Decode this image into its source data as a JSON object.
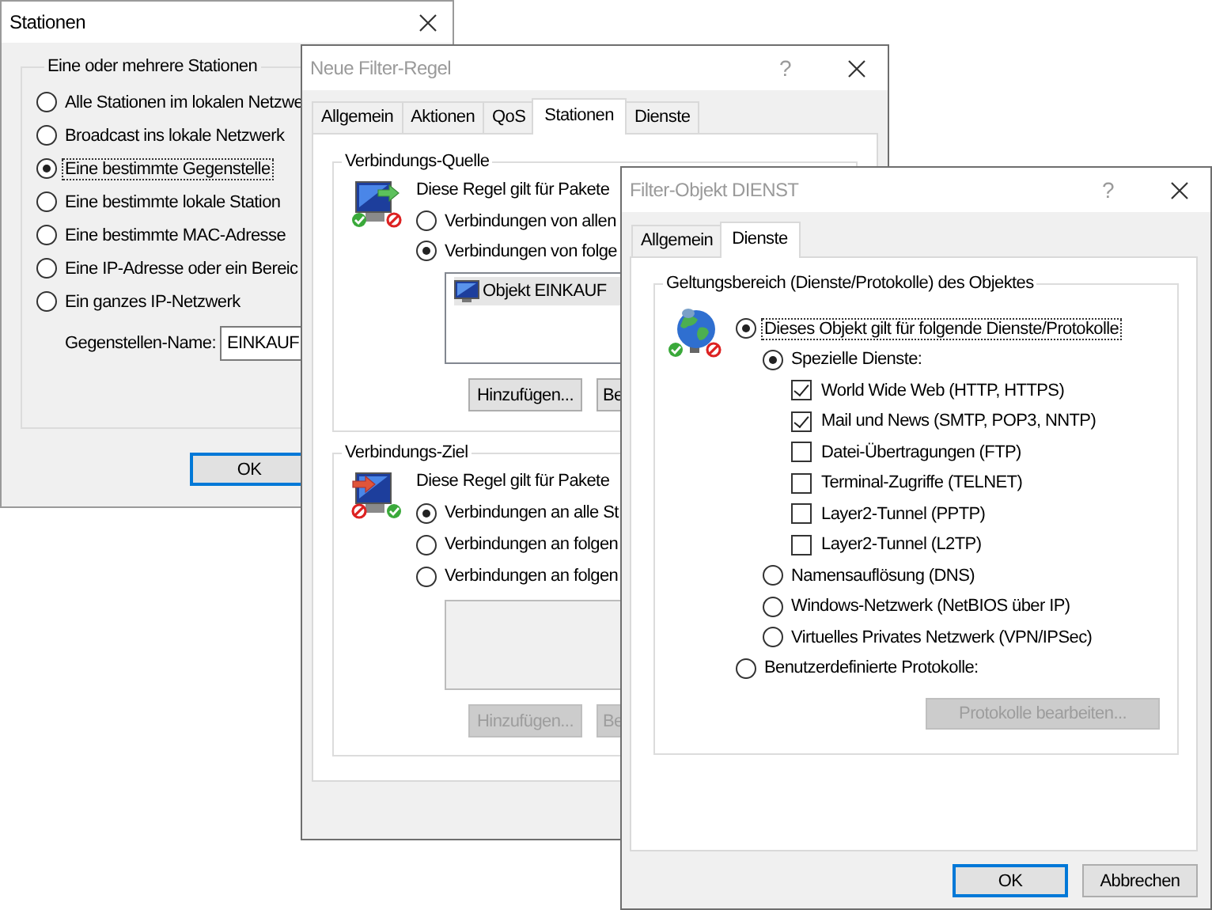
{
  "stations_dialog": {
    "title": "Stationen",
    "active": true,
    "group": {
      "title": "Eine oder mehrere Stationen",
      "options": [
        {
          "label": "Alle Stationen im lokalen Netzwe",
          "selected": false,
          "focused": false
        },
        {
          "label": "Broadcast ins lokale Netzwerk",
          "selected": false,
          "focused": false
        },
        {
          "label": "Eine bestimmte Gegenstelle",
          "selected": true,
          "focused": true
        },
        {
          "label": "Eine bestimmte lokale Station",
          "selected": false,
          "focused": false
        },
        {
          "label": "Eine bestimmte MAC-Adresse",
          "selected": false,
          "focused": false
        },
        {
          "label": "Eine IP-Adresse oder ein Bereic",
          "selected": false,
          "focused": false
        },
        {
          "label": "Ein ganzes IP-Netzwerk",
          "selected": false,
          "focused": false
        }
      ]
    },
    "name_field": {
      "label": "Gegenstellen-Name:",
      "value": "EINKAUF"
    },
    "buttons": [
      {
        "label": "OK",
        "default": true
      }
    ]
  },
  "filter_rule_dialog": {
    "title": "Neue Filter-Regel",
    "active": false,
    "help": "?",
    "tabs": [
      {
        "label": "Allgemein",
        "selected": false
      },
      {
        "label": "Aktionen",
        "selected": false
      },
      {
        "label": "QoS",
        "selected": false
      },
      {
        "label": "Stationen",
        "selected": true
      },
      {
        "label": "Dienste",
        "selected": false
      }
    ],
    "groups": [
      {
        "kind": "source",
        "title": "Verbindungs-Quelle",
        "description": "Diese Regel gilt für Pakete",
        "options": [
          {
            "label": "Verbindungen von allen",
            "selected": false
          },
          {
            "label": "Verbindungen von folge",
            "selected": true
          }
        ],
        "list": [
          {
            "label": "Objekt EINKAUF",
            "selected": true
          }
        ],
        "buttons": [
          {
            "label": "Hinzufügen...",
            "disabled": false
          },
          {
            "label": "Be",
            "disabled": false
          }
        ]
      },
      {
        "kind": "target",
        "title": "Verbindungs-Ziel",
        "description": "Diese Regel gilt für Pakete",
        "options": [
          {
            "label": "Verbindungen an alle St",
            "selected": true
          },
          {
            "label": "Verbindungen an folgen",
            "selected": false
          },
          {
            "label": "Verbindungen an folgen",
            "selected": false
          }
        ],
        "buttons": [
          {
            "label": "Hinzufügen...",
            "disabled": true
          },
          {
            "label": "Be",
            "disabled": true
          }
        ]
      }
    ]
  },
  "filter_object_dialog": {
    "title": "Filter-Objekt DIENST",
    "active": false,
    "help": "?",
    "tabs": [
      {
        "label": "Allgemein",
        "selected": false
      },
      {
        "label": "Dienste",
        "selected": true
      }
    ],
    "scope": {
      "title": "Geltungsbereich (Dienste/Protokolle) des Objektes",
      "options": [
        {
          "kind": "radio",
          "label": "Dieses Objekt gilt für folgende Dienste/Protokolle",
          "selected": true,
          "focused": true,
          "children": [
            {
              "kind": "radio",
              "label": "Spezielle Dienste:",
              "selected": true,
              "focused": false,
              "children": [
                {
                  "kind": "checkbox",
                  "label": "World Wide Web (HTTP, HTTPS)",
                  "checked": true
                },
                {
                  "kind": "checkbox",
                  "label": "Mail und News (SMTP, POP3, NNTP)",
                  "checked": true
                },
                {
                  "kind": "checkbox",
                  "label": "Datei-Übertragungen (FTP)",
                  "checked": false
                },
                {
                  "kind": "checkbox",
                  "label": "Terminal-Zugriffe (TELNET)",
                  "checked": false
                },
                {
                  "kind": "checkbox",
                  "label": "Layer2-Tunnel (PPTP)",
                  "checked": false
                },
                {
                  "kind": "checkbox",
                  "label": "Layer2-Tunnel (L2TP)",
                  "checked": false
                }
              ]
            },
            {
              "kind": "radio",
              "label": "Namensauflösung (DNS)",
              "selected": false,
              "focused": false
            },
            {
              "kind": "radio",
              "label": "Windows-Netzwerk (NetBIOS über IP)",
              "selected": false,
              "focused": false
            },
            {
              "kind": "radio",
              "label": "Virtuelles Privates Netzwerk (VPN/IPSec)",
              "selected": false,
              "focused": false
            }
          ]
        },
        {
          "kind": "radio",
          "label": "Benutzerdefinierte Protokolle:",
          "selected": false,
          "focused": false
        }
      ],
      "button": {
        "label": "Protokolle bearbeiten...",
        "disabled": true
      }
    },
    "buttons": [
      {
        "label": "OK",
        "default": true
      },
      {
        "label": "Abbrechen",
        "default": false
      }
    ]
  }
}
